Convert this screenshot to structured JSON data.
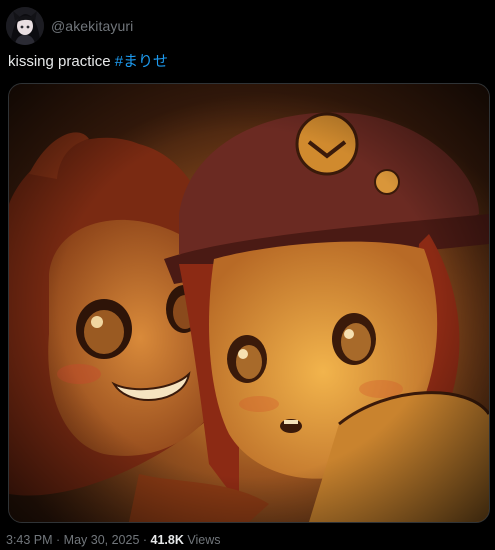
{
  "author": {
    "handle": "@akekitayuri"
  },
  "tweet": {
    "text": "kissing practice ",
    "hashtag": "#まりせ"
  },
  "media": {
    "icon": "artwork-image"
  },
  "meta": {
    "time": "3:43 PM",
    "separator1": " · ",
    "date": "May 30, 2025",
    "separator2": " · ",
    "views_count": "41.8K",
    "views_label": " Views"
  },
  "colors": {
    "background": "#000000",
    "text": "#e7e9ea",
    "muted": "#71767b",
    "link": "#1d9bf0"
  }
}
